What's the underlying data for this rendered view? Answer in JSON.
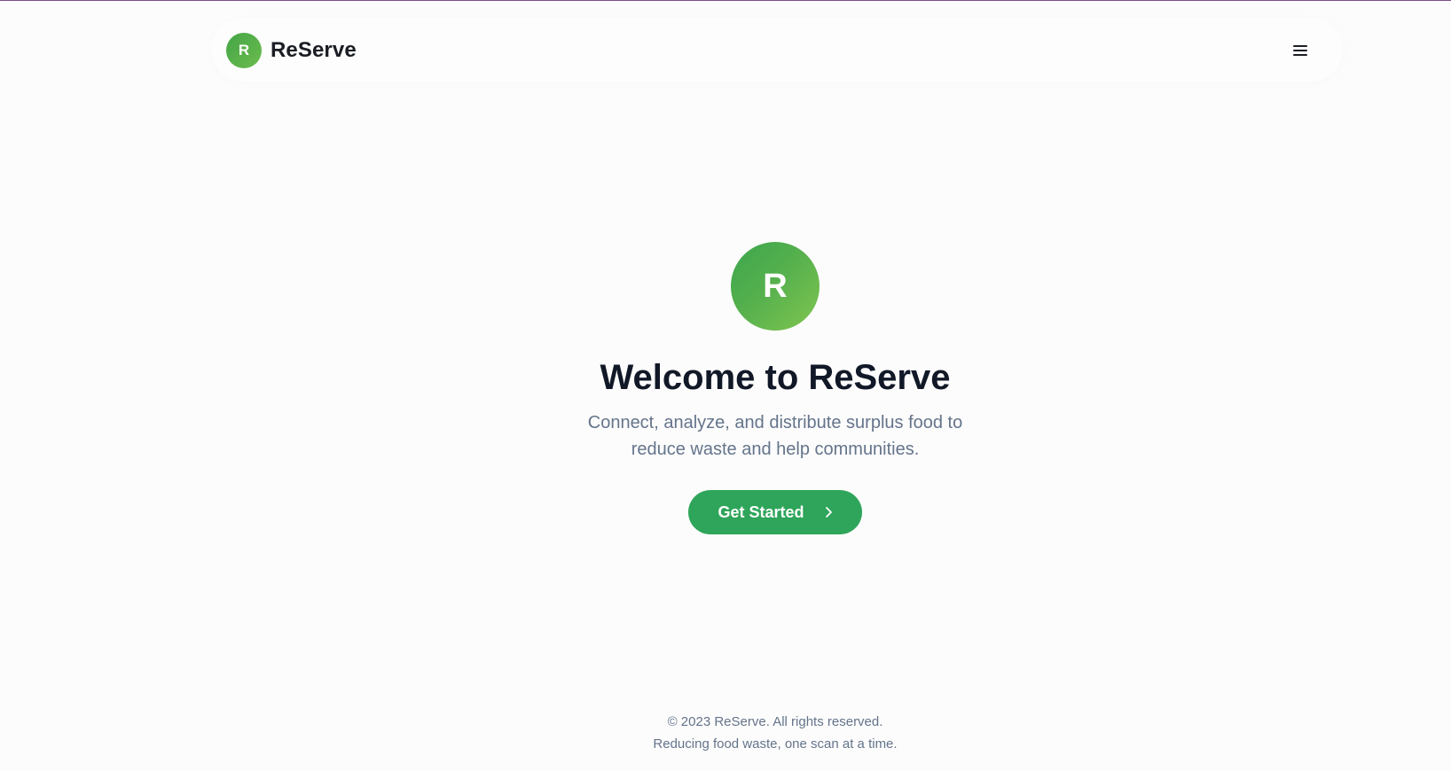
{
  "header": {
    "logo_letter": "R",
    "brand_name": "ReServe",
    "menu_icon": "hamburger-menu-icon"
  },
  "hero": {
    "logo_letter": "R",
    "title": "Welcome to ReServe",
    "subtitle": "Connect, analyze, and distribute surplus food to reduce waste and help communities.",
    "cta_label": "Get Started",
    "cta_icon": "chevron-right-icon"
  },
  "footer": {
    "copyright": "© 2023 ReServe. All rights reserved.",
    "tagline": "Reducing food waste, one scan at a time."
  },
  "colors": {
    "brand_green": "#2ea55a",
    "logo_gradient_start": "#3ca64d",
    "logo_gradient_end": "#80c550",
    "text_dark": "#111827",
    "text_muted": "#64748b"
  }
}
